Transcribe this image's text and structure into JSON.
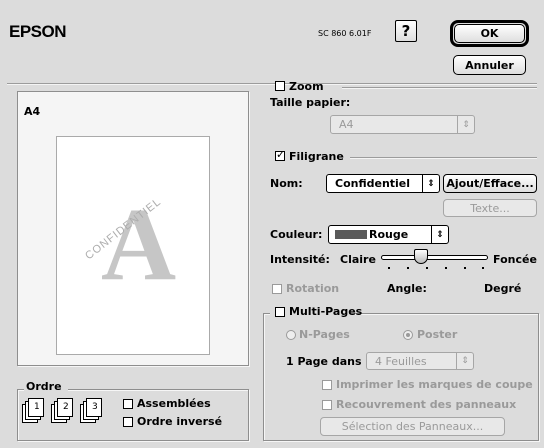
{
  "header": {
    "brand": "EPSON",
    "version": "SC 860 6.01F",
    "help_label": "?",
    "ok_label": "OK",
    "cancel_label": "Annuler"
  },
  "preview": {
    "paper_label": "A4",
    "watermark_letter": "A",
    "watermark_text": "CONFIDENTIEL"
  },
  "zoom": {
    "label": "Zoom",
    "checked": false,
    "paper_size_label": "Taille papier:",
    "paper_size_value": "A4"
  },
  "filigrane": {
    "label": "Filigrane",
    "checked": true,
    "name_label": "Nom:",
    "name_value": "Confidentiel",
    "add_button": "Ajout/Efface...",
    "text_button": "Texte...",
    "color_label": "Couleur:",
    "color_value": "Rouge",
    "color_swatch": "#5a5a5a",
    "intensity_label": "Intensité:",
    "intensity_min": "Claire",
    "intensity_max": "Foncée",
    "intensity_level": 0.35,
    "rotation_label": "Rotation",
    "angle_label": "Angle:",
    "angle_value": "Degré"
  },
  "multipages": {
    "label": "Multi-Pages",
    "npages_label": "N-Pages",
    "poster_label": "Poster",
    "page_in_label": "1 Page dans",
    "sheets_value": "4 Feuilles",
    "print_marks_label": "Imprimer les marques de coupe",
    "overlap_label": "Recouvrement des panneaux",
    "select_panels_button": "Sélection des Panneaux..."
  },
  "ordre": {
    "label": "Ordre",
    "page_numbers": [
      "1",
      "2",
      "3"
    ],
    "assembled_label": "Assemblées",
    "reverse_label": "Ordre inversé"
  }
}
